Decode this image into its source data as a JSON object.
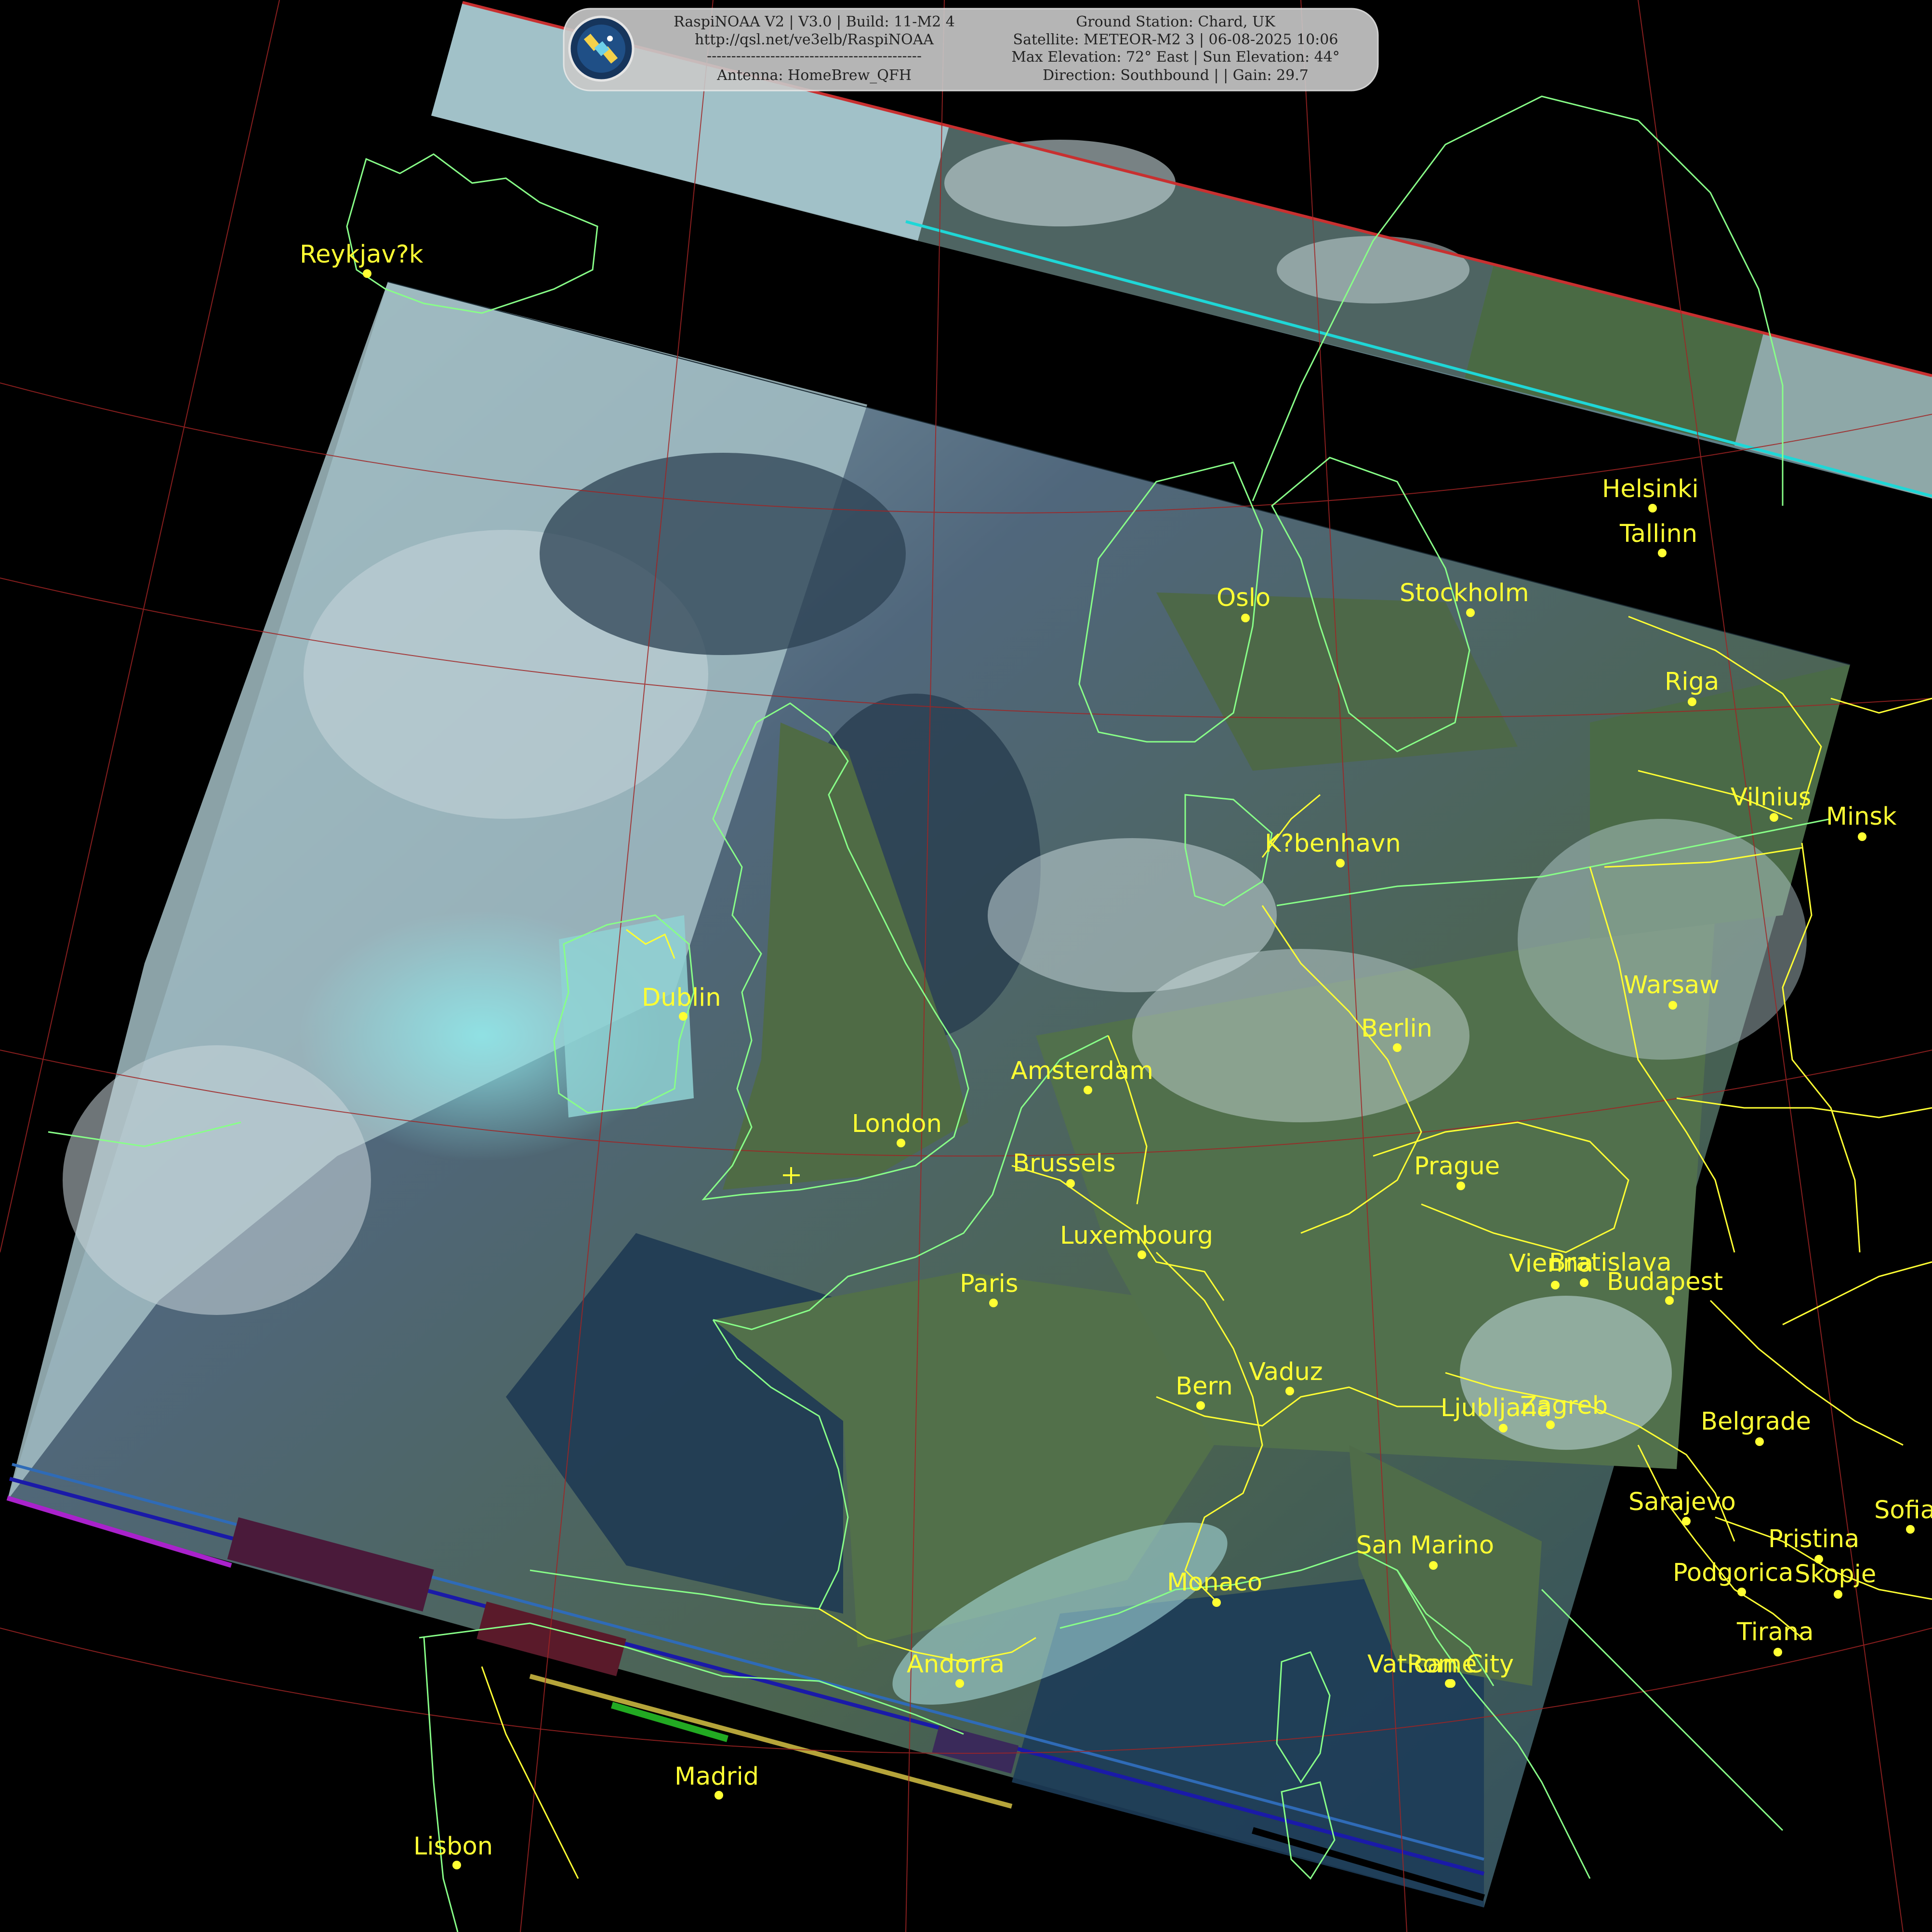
{
  "header": {
    "left_lines": [
      "RaspiNOAA V2 | V3.0 | Build: 11-M2 4",
      "http://qsl.net/ve3elb/RaspiNOAA",
      "--------------------------------------------",
      "Antenna: HomeBrew_QFH"
    ],
    "right_lines": [
      "Ground Station: Chard, UK",
      "Satellite: METEOR-M2 3 | 06-08-2025 10:06",
      "Max Elevation: 72° East | Sun Elevation: 44°",
      "Direction: Southbound | | Gain: 29.7"
    ],
    "logo": "satellite-logo-icon"
  },
  "ground_station_marker": "crosshair-icon",
  "colors": {
    "label": "#ffff33",
    "coastline": "#88ff88",
    "border": "#ffff33",
    "graticule": "#aa2222"
  },
  "cities": [
    {
      "id": "reykjavik",
      "name": "Reykjav?k"
    },
    {
      "id": "helsinki",
      "name": "Helsinki"
    },
    {
      "id": "tallinn",
      "name": "Tallinn"
    },
    {
      "id": "oslo",
      "name": "Oslo"
    },
    {
      "id": "stockholm",
      "name": "Stockholm"
    },
    {
      "id": "riga",
      "name": "Riga"
    },
    {
      "id": "vilnius",
      "name": "Vilnius"
    },
    {
      "id": "minsk",
      "name": "Minsk"
    },
    {
      "id": "kobenhavn",
      "name": "K?benhavn"
    },
    {
      "id": "dublin",
      "name": "Dublin"
    },
    {
      "id": "warsaw",
      "name": "Warsaw"
    },
    {
      "id": "berlin",
      "name": "Berlin"
    },
    {
      "id": "amsterdam",
      "name": "Amsterdam"
    },
    {
      "id": "london",
      "name": "London"
    },
    {
      "id": "brussels",
      "name": "Brussels"
    },
    {
      "id": "prague",
      "name": "Prague"
    },
    {
      "id": "luxembourg",
      "name": "Luxembourg"
    },
    {
      "id": "vienna",
      "name": "Vienna"
    },
    {
      "id": "bratislava",
      "name": "Bratislava"
    },
    {
      "id": "budapest",
      "name": "Budapest"
    },
    {
      "id": "paris",
      "name": "Paris"
    },
    {
      "id": "vaduz",
      "name": "Vaduz"
    },
    {
      "id": "bern",
      "name": "Bern"
    },
    {
      "id": "ljubljana",
      "name": "Ljubljana"
    },
    {
      "id": "zagreb",
      "name": "Zagreb"
    },
    {
      "id": "belgrade",
      "name": "Belgrade"
    },
    {
      "id": "sarajevo",
      "name": "Sarajevo"
    },
    {
      "id": "sofia",
      "name": "Sofia"
    },
    {
      "id": "san_marino",
      "name": "San Marino"
    },
    {
      "id": "pristina",
      "name": "Pristina"
    },
    {
      "id": "podgorica",
      "name": "Podgorica"
    },
    {
      "id": "skopje",
      "name": "Skopje"
    },
    {
      "id": "monaco",
      "name": "Monaco"
    },
    {
      "id": "tirana",
      "name": "Tirana"
    },
    {
      "id": "andorra",
      "name": "Andorra"
    },
    {
      "id": "vatican",
      "name": "Vatican City"
    },
    {
      "id": "rome",
      "name": "Rome"
    },
    {
      "id": "madrid",
      "name": "Madrid"
    },
    {
      "id": "lisbon",
      "name": "Lisbon"
    }
  ]
}
